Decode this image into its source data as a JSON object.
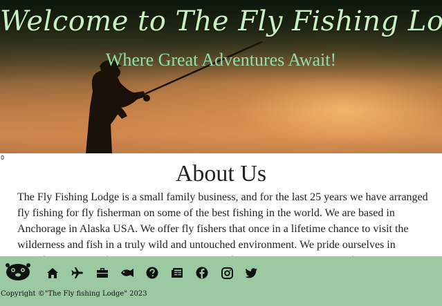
{
  "hero": {
    "title": "Welcome to The Fly Fishing Lodge",
    "subtitle": "Where Great Adventures Await!"
  },
  "stray_char": "0",
  "about": {
    "title": "About Us",
    "text": "The Fly Fishing Lodge is a small family business, and for the last 25 years we have arranged fly fishing for fly fisherman on some of the best fishing in the world. We are based in Anchorage in Alaska USA. We offer fly fishers that once in a lifetime chance to visit the wilderness and fish in a truly wild and untouched environment. We pride ourselves in providing a unique destination with some of the best fly fishing in the world."
  },
  "footer": {
    "icons": [
      "otter-logo",
      "home-icon",
      "plane-icon",
      "briefcase-icon",
      "fish-icon",
      "question-icon",
      "newspaper-icon",
      "facebook-icon",
      "instagram-icon",
      "twitter-icon"
    ],
    "copyright": "Copyright ©\"The Fly fishing Lodge\" 2023",
    "background_color": "#9ac9a2"
  }
}
